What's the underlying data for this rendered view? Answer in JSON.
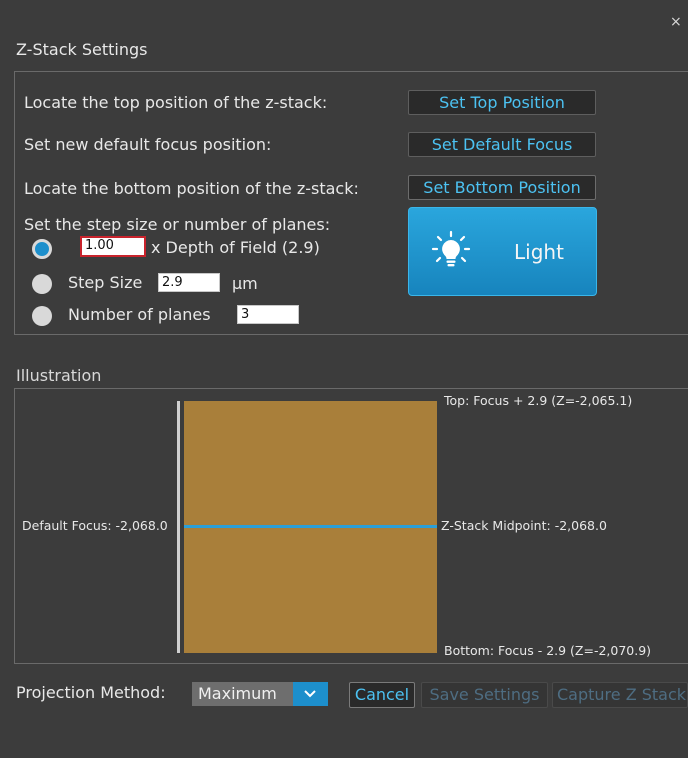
{
  "window": {
    "title": "Z-Stack Settings",
    "close_glyph": "×"
  },
  "positions": {
    "top_label": "Locate the top position of the z-stack:",
    "top_button": "Set Top Position",
    "default_label": "Set new default focus position:",
    "default_button": "Set Default Focus",
    "bottom_label": "Locate the bottom position of the z-stack:",
    "bottom_button": "Set Bottom Position"
  },
  "step": {
    "label": "Set the step size or number of planes:",
    "dof_value": "1.00",
    "dof_label": "x Depth of Field (2.9)",
    "step_label": "Step Size",
    "step_value": "2.9",
    "step_unit": "µm",
    "planes_label": "Number of planes",
    "planes_value": "3",
    "selected": "depth_of_field"
  },
  "light_button": {
    "label": "Light",
    "icon": "light-bulb-icon"
  },
  "illustration": {
    "title": "Illustration",
    "top_label": "Top: Focus + 2.9 (Z=-2,065.1)",
    "default_focus": "Default Focus: -2,068.0",
    "midpoint": "Z-Stack Midpoint: -2,068.0",
    "bottom_label": "Bottom: Focus - 2.9 (Z=-2,070.9)",
    "stack_color": "#a97f3a",
    "midline_color": "#2b9fd8"
  },
  "footer": {
    "projection_label": "Projection Method:",
    "projection_value": "Maximum",
    "cancel": "Cancel",
    "save": "Save Settings",
    "capture": "Capture Z Stack"
  },
  "colors": {
    "accent": "#1d8fcc",
    "link_text": "#4cc2f2",
    "background": "#3c3c3c"
  }
}
